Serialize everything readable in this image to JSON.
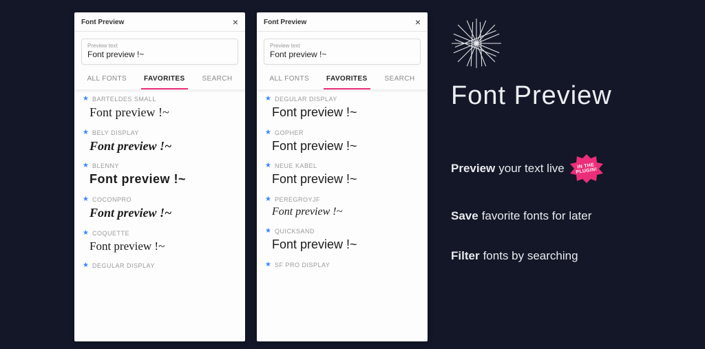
{
  "panel": {
    "title": "Font Preview",
    "preview_label": "Preview text",
    "preview_value": "Font preview !~",
    "tabs": {
      "all": "ALL FONTS",
      "favorites": "FAVORITES",
      "search": "SEARCH"
    }
  },
  "left_fonts": [
    {
      "name": "BARTELDES SMALL",
      "sample": "Font preview !~",
      "style": "f-serif"
    },
    {
      "name": "BELY DISPLAY",
      "sample": "Font preview !~",
      "style": "f-display"
    },
    {
      "name": "BLENNY",
      "sample": "Font preview !~",
      "style": "f-black"
    },
    {
      "name": "COCONPRO",
      "sample": "Font preview !~",
      "style": "f-italbold"
    },
    {
      "name": "COQUETTE",
      "sample": "Font preview !~",
      "style": "f-script"
    },
    {
      "name": "DEGULAR DISPLAY",
      "sample": "",
      "style": ""
    }
  ],
  "right_fonts": [
    {
      "name": "DEGULAR DISPLAY",
      "sample": "Font preview !~",
      "style": "f-sans"
    },
    {
      "name": "GOPHER",
      "sample": "Font preview !~",
      "style": "f-round"
    },
    {
      "name": "NEUE KABEL",
      "sample": "Font preview !~",
      "style": "f-sanslt"
    },
    {
      "name": "PEREGROYJF",
      "sample": "Font preview !~",
      "style": "f-cursive"
    },
    {
      "name": "QUICKSAND",
      "sample": "Font preview !~",
      "style": "f-sanslt"
    },
    {
      "name": "SF PRO DISPLAY",
      "sample": "",
      "style": ""
    }
  ],
  "hero": {
    "title": "Font Preview",
    "badge_line1": "IN THE",
    "badge_line2": "PLUGIN!",
    "features": [
      {
        "bold": "Preview",
        "rest": "your text live",
        "badge": true
      },
      {
        "bold": "Save",
        "rest": "favorite fonts for later",
        "badge": false
      },
      {
        "bold": "Filter",
        "rest": "fonts by searching",
        "badge": false
      }
    ]
  }
}
